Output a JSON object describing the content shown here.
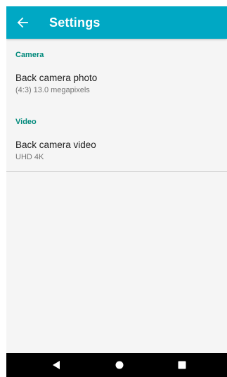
{
  "app_bar": {
    "title": "Settings",
    "back_icon": "arrow-left-icon",
    "color": "#00a8c4"
  },
  "sections": [
    {
      "header": "Camera",
      "items": [
        {
          "title": "Back camera photo",
          "summary": "(4:3) 13.0 megapixels"
        }
      ]
    },
    {
      "header": "Video",
      "items": [
        {
          "title": "Back camera video",
          "summary": "UHD 4K"
        }
      ]
    }
  ],
  "navigation_bar": {
    "back_icon": "triangle-back-icon",
    "home_icon": "circle-home-icon",
    "recents_icon": "square-recents-icon"
  },
  "colors": {
    "accent": "#00a8c4",
    "section_header": "#00897b",
    "background": "#f5f5f5",
    "nav_bar": "#000000"
  }
}
